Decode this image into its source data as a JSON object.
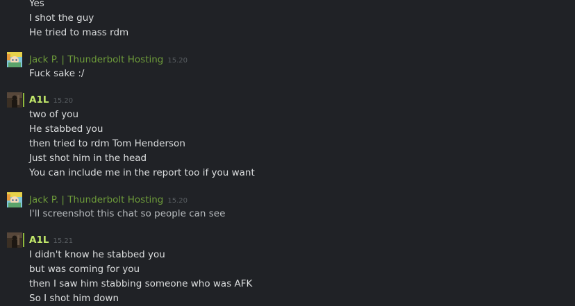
{
  "messages_top": {
    "lines": [
      "Yes",
      "I shot the guy",
      "He tried to mass rdm"
    ]
  },
  "groups": [
    {
      "sender": "Jack P. | Thunderbolt Hosting",
      "time": "15.20",
      "avatar_icon": "anime-avatar-icon",
      "lines": [
        "Fuck sake :/"
      ]
    },
    {
      "sender": "A1L",
      "time": "15.20",
      "avatar_icon": "dark-figure-avatar-icon",
      "lines": [
        "two of you",
        "He stabbed you",
        "then tried to rdm Tom Henderson",
        "Just shot him in the head",
        "You can include me in the report too if you want"
      ]
    },
    {
      "sender": "Jack P. | Thunderbolt Hosting",
      "time": "15.20",
      "avatar_icon": "anime-avatar-icon",
      "lines": [
        "I'll screenshot this chat so people can see"
      ]
    },
    {
      "sender": "A1L",
      "time": "15.21",
      "avatar_icon": "dark-figure-avatar-icon",
      "lines": [
        "I didn't know he stabbed you",
        "but was coming for you",
        "then I saw him stabbing someone who was AFK",
        "So I shot him down"
      ]
    }
  ],
  "colors": {
    "background": "#202226",
    "other_user_name": "#6d9b3a",
    "self_name": "#c2e86a",
    "ingame_bar": "#90ba3c"
  }
}
